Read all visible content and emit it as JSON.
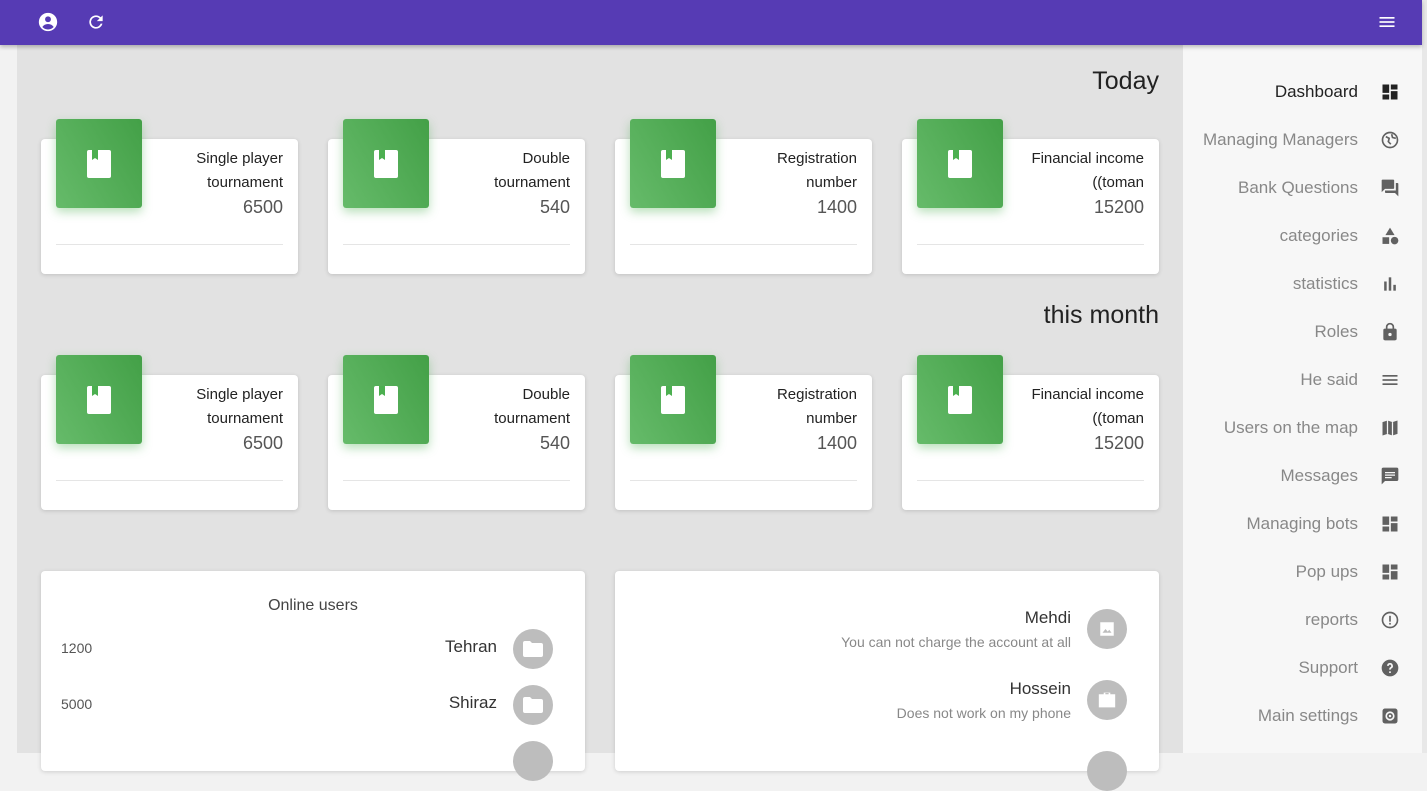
{
  "topbar": {
    "accent": "#563bb4",
    "icons": [
      "account-circle-icon",
      "refresh-icon",
      "menu-icon"
    ]
  },
  "sections": {
    "today": "Today",
    "month": "this month"
  },
  "today_cards": [
    {
      "line1": "Single player",
      "line2": "tournament",
      "value": "6500"
    },
    {
      "line1": "Double",
      "line2": "tournament",
      "value": "540"
    },
    {
      "line1": "Registration",
      "line2": "number",
      "value": "1400"
    },
    {
      "line1": "Financial income",
      "line2": "((toman",
      "value": "15200"
    }
  ],
  "month_cards": [
    {
      "line1": "Single player",
      "line2": "tournament",
      "value": "6500"
    },
    {
      "line1": "Double",
      "line2": "tournament",
      "value": "540"
    },
    {
      "line1": "Registration",
      "line2": "number",
      "value": "1400"
    },
    {
      "line1": "Financial income",
      "line2": "((toman",
      "value": "15200"
    }
  ],
  "online_users": {
    "title": "Online users",
    "rows": [
      {
        "count": "1200",
        "city": "Tehran"
      },
      {
        "count": "5000",
        "city": "Shiraz"
      }
    ]
  },
  "messages": [
    {
      "name": "Mehdi",
      "text": "You can not charge the account at all",
      "icon": "image-icon"
    },
    {
      "name": "Hossein",
      "text": "Does not work on my phone",
      "icon": "briefcase-icon"
    }
  ],
  "sidebar": {
    "items": [
      {
        "label": "Dashboard",
        "icon": "dashboard-icon",
        "active": true
      },
      {
        "label": "Managing Managers",
        "icon": "globe-icon"
      },
      {
        "label": "Bank Questions",
        "icon": "forum-icon"
      },
      {
        "label": "categories",
        "icon": "category-icon"
      },
      {
        "label": "statistics",
        "icon": "bar-chart-icon"
      },
      {
        "label": "Roles",
        "icon": "lock-icon"
      },
      {
        "label": "He said",
        "icon": "list-icon"
      },
      {
        "label": "Users on the map",
        "icon": "map-icon"
      },
      {
        "label": "Messages",
        "icon": "message-icon"
      },
      {
        "label": "Managing bots",
        "icon": "dashboard-icon"
      },
      {
        "label": "Pop ups",
        "icon": "dashboard-icon"
      },
      {
        "label": "reports",
        "icon": "alert-circle-icon"
      },
      {
        "label": "Support",
        "icon": "help-circle-icon"
      },
      {
        "label": "Main settings",
        "icon": "settings-icon"
      }
    ]
  }
}
